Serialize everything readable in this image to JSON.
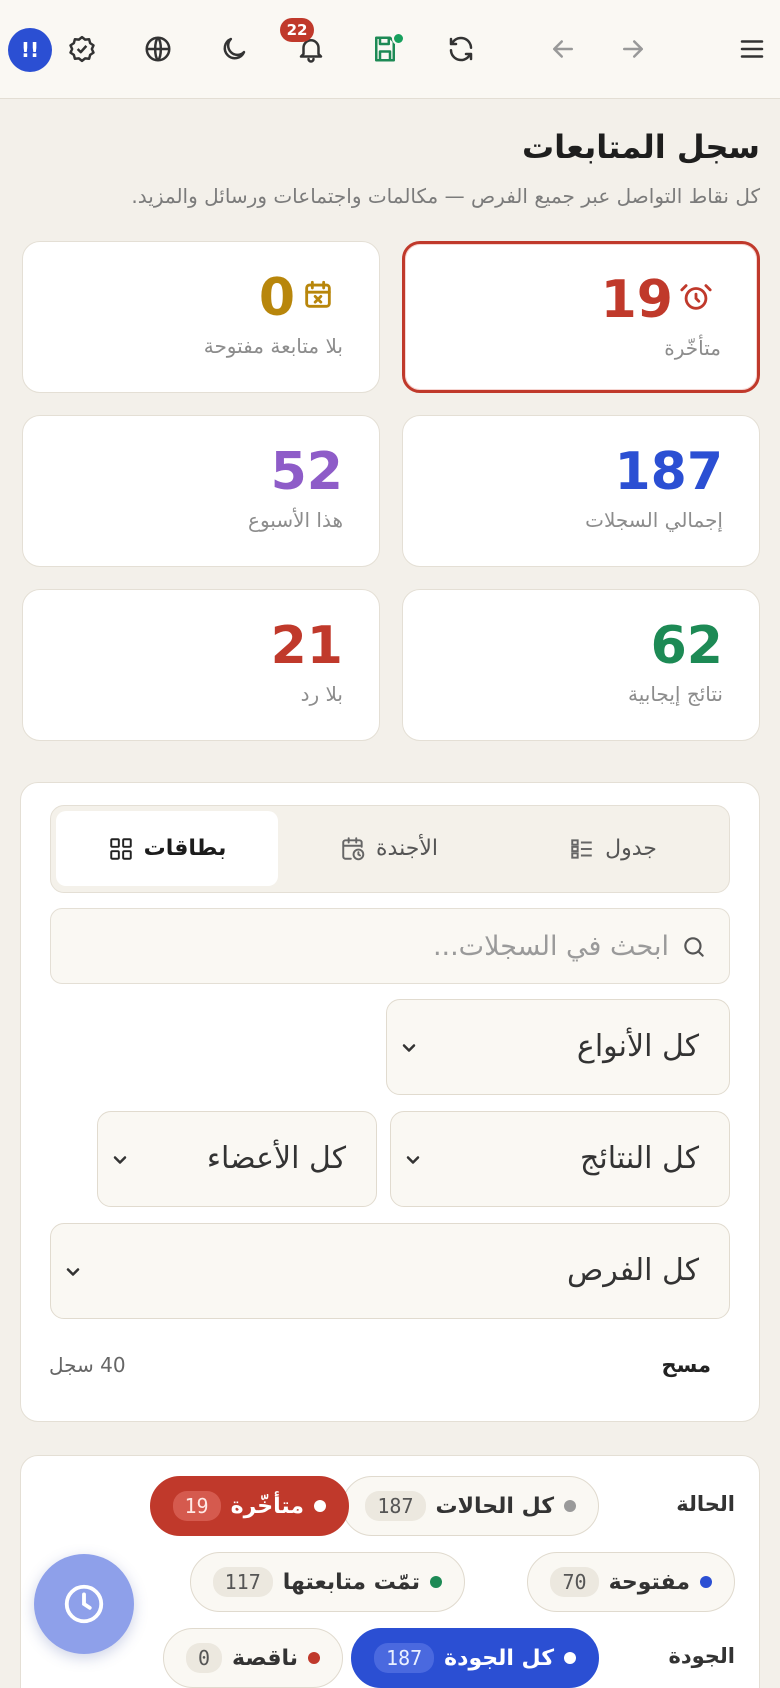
{
  "topbar": {
    "avatar_initial": "!!",
    "notifications_count": "22"
  },
  "header": {
    "title": "سجل المتابعات",
    "subtitle": "كل نقاط التواصل عبر جميع الفرص — مكالمات واجتماعات ورسائل والمزيد."
  },
  "stats": [
    {
      "label": "متأخّرة",
      "value": "19",
      "color": "#c0392b",
      "icon": "alarm-clock-icon"
    },
    {
      "label": "بلا متابعة مفتوحة",
      "value": "0",
      "color": "#b8860b",
      "icon": "calendar-x-icon"
    },
    {
      "label": "إجمالي السجلات",
      "value": "187",
      "color": "#2b4fd3"
    },
    {
      "label": "هذا الأسبوع",
      "value": "52",
      "color": "#8e5cc8"
    },
    {
      "label": "نتائج إيجابية",
      "value": "62",
      "color": "#1d8a55"
    },
    {
      "label": "بلا رد",
      "value": "21",
      "color": "#c0392b"
    }
  ],
  "view_tabs": [
    {
      "label": "جدول",
      "icon": "list-icon"
    },
    {
      "label": "الأجندة",
      "icon": "calendar-clock-icon"
    },
    {
      "label": "بطاقات",
      "icon": "grid-icon",
      "active": true
    }
  ],
  "search": {
    "placeholder": "ابحث في السجلات..."
  },
  "filters": {
    "types": "كل الأنواع",
    "results": "كل النتائج",
    "members": "كل الأعضاء",
    "opportunities": "كل الفرص"
  },
  "panel_footer": {
    "clear": "مسح",
    "count": "40 سجل"
  },
  "status_row": {
    "label": "الحالة",
    "chips": [
      {
        "label": "كل الحالات",
        "count": "187",
        "dot": "#9a9a9a"
      },
      {
        "label": "متأخّرة",
        "count": "19",
        "dot": "#ffffff"
      },
      {
        "label": "مفتوحة",
        "count": "70",
        "dot": "#2b4fd3"
      },
      {
        "label": "تمّت متابعتها",
        "count": "117",
        "dot": "#1d8a55"
      }
    ]
  },
  "quality_row": {
    "label": "الجودة",
    "chips": [
      {
        "label": "كل الجودة",
        "count": "187",
        "dot": "#ffffff"
      },
      {
        "label": "ناقصة",
        "count": "0",
        "dot": "#c0392b"
      }
    ]
  }
}
